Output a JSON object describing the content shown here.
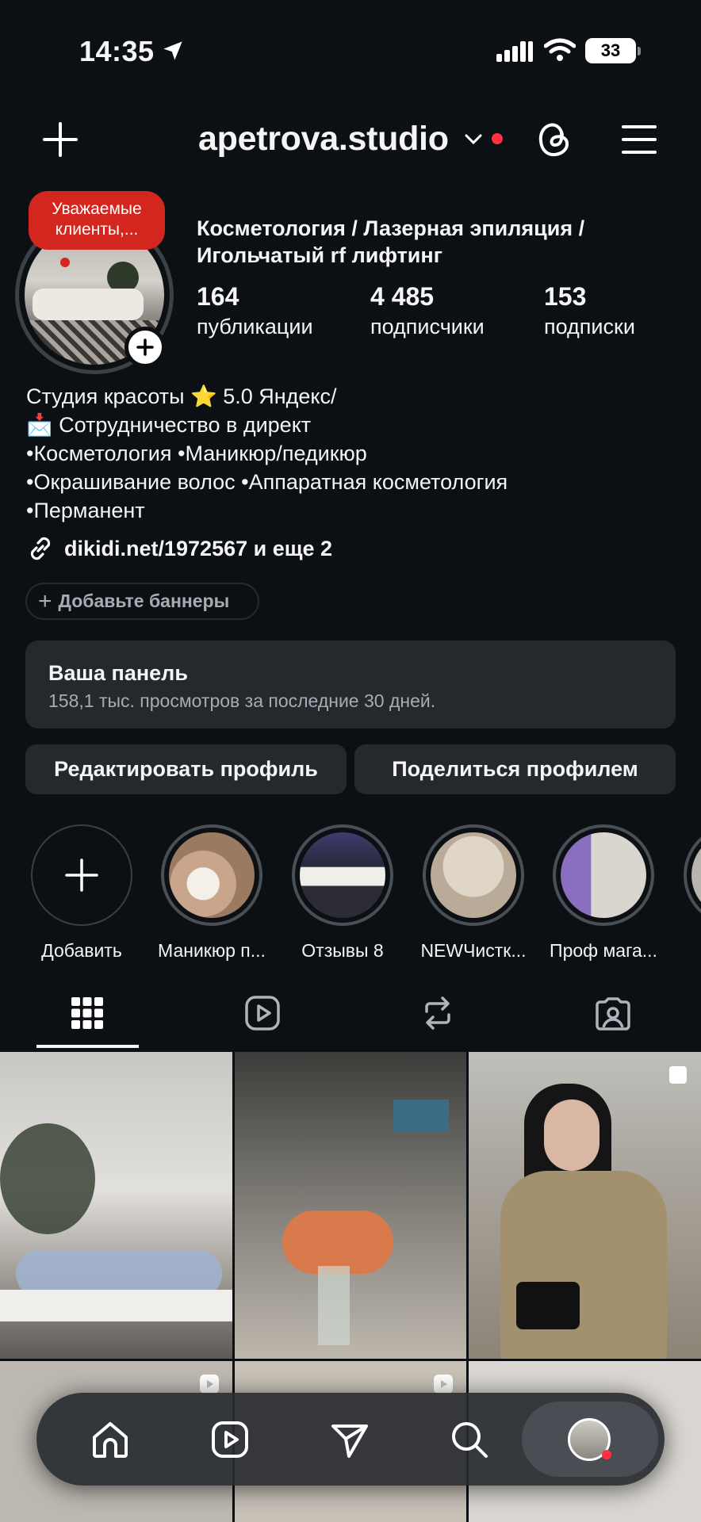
{
  "status_bar": {
    "time": "14:35",
    "battery": "33"
  },
  "header": {
    "username": "apetrova.studio"
  },
  "profile": {
    "note": "Уважаемые клиенты,...",
    "category": "Косметология / Лазерная эпиляция / Игольчатый rf лифтинг",
    "stats": [
      {
        "value": "164",
        "label": "публикации"
      },
      {
        "value": "4 485",
        "label": "подписчики"
      },
      {
        "value": "153",
        "label": "подписки"
      }
    ],
    "bio": [
      "Студия красоты ⭐️ 5.0 Яндекс/",
      "📩 Сотрудничество в директ",
      "•Косметология •Маникюр/педикюр",
      "•Окрашивание волос •Аппаратная косметология",
      "•Перманент"
    ],
    "link": "dikidi.net/1972567 и еще 2",
    "add_banners": "Добавьте баннеры"
  },
  "dashboard": {
    "title": "Ваша панель",
    "subtitle": "158,1 тыс. просмотров за последние 30 дней."
  },
  "actions": {
    "edit": "Редактировать профиль",
    "share": "Поделиться профилем"
  },
  "highlights": [
    {
      "label": "Добавить"
    },
    {
      "label": "Маникюр п..."
    },
    {
      "label": "Отзывы 8"
    },
    {
      "label": "NEWЧистк..."
    },
    {
      "label": "Проф мага..."
    }
  ],
  "colors": {
    "background": "#0c1014",
    "accent_red": "#ff3040",
    "note_red": "#d3261f"
  }
}
